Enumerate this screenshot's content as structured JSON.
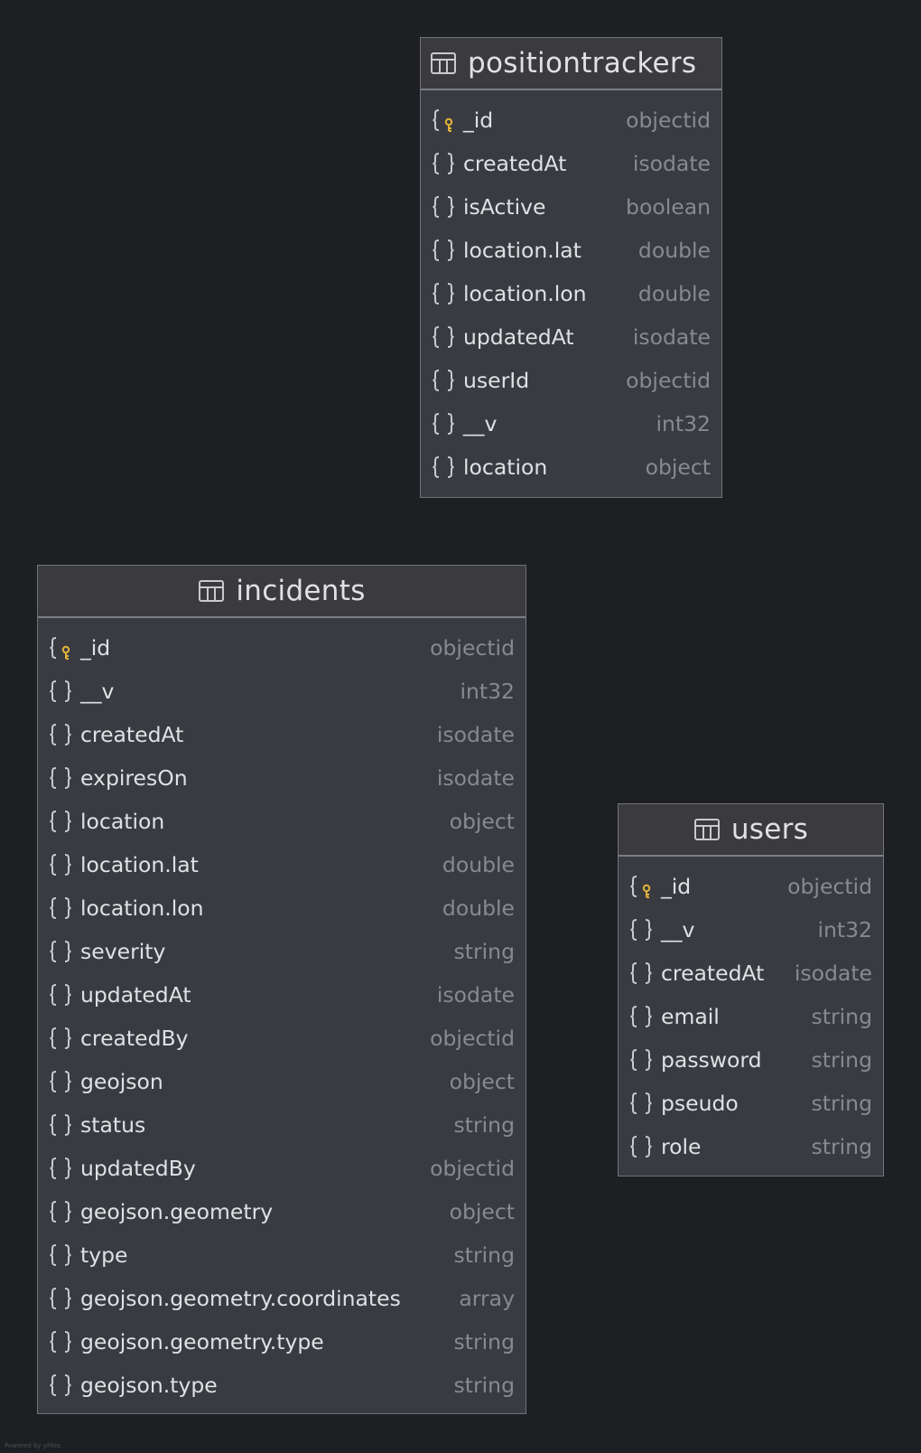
{
  "tables": [
    {
      "name": "positiontrackers",
      "fields": [
        {
          "name": "_id",
          "type": "objectid",
          "key": true
        },
        {
          "name": "createdAt",
          "type": "isodate",
          "key": false
        },
        {
          "name": "isActive",
          "type": "boolean",
          "key": false
        },
        {
          "name": "location.lat",
          "type": "double",
          "key": false
        },
        {
          "name": "location.lon",
          "type": "double",
          "key": false
        },
        {
          "name": "updatedAt",
          "type": "isodate",
          "key": false
        },
        {
          "name": "userId",
          "type": "objectid",
          "key": false
        },
        {
          "name": "__v",
          "type": "int32",
          "key": false
        },
        {
          "name": "location",
          "type": "object",
          "key": false
        }
      ]
    },
    {
      "name": "incidents",
      "fields": [
        {
          "name": "_id",
          "type": "objectid",
          "key": true
        },
        {
          "name": "__v",
          "type": "int32",
          "key": false
        },
        {
          "name": "createdAt",
          "type": "isodate",
          "key": false
        },
        {
          "name": "expiresOn",
          "type": "isodate",
          "key": false
        },
        {
          "name": "location",
          "type": "object",
          "key": false
        },
        {
          "name": "location.lat",
          "type": "double",
          "key": false
        },
        {
          "name": "location.lon",
          "type": "double",
          "key": false
        },
        {
          "name": "severity",
          "type": "string",
          "key": false
        },
        {
          "name": "updatedAt",
          "type": "isodate",
          "key": false
        },
        {
          "name": "createdBy",
          "type": "objectid",
          "key": false
        },
        {
          "name": "geojson",
          "type": "object",
          "key": false
        },
        {
          "name": "status",
          "type": "string",
          "key": false
        },
        {
          "name": "updatedBy",
          "type": "objectid",
          "key": false
        },
        {
          "name": "geojson.geometry",
          "type": "object",
          "key": false
        },
        {
          "name": "type",
          "type": "string",
          "key": false
        },
        {
          "name": "geojson.geometry.coordinates",
          "type": "array",
          "key": false
        },
        {
          "name": "geojson.geometry.type",
          "type": "string",
          "key": false
        },
        {
          "name": "geojson.type",
          "type": "string",
          "key": false
        }
      ]
    },
    {
      "name": "users",
      "fields": [
        {
          "name": "_id",
          "type": "objectid",
          "key": true
        },
        {
          "name": "__v",
          "type": "int32",
          "key": false
        },
        {
          "name": "createdAt",
          "type": "isodate",
          "key": false
        },
        {
          "name": "email",
          "type": "string",
          "key": false
        },
        {
          "name": "password",
          "type": "string",
          "key": false
        },
        {
          "name": "pseudo",
          "type": "string",
          "key": false
        },
        {
          "name": "role",
          "type": "string",
          "key": false
        }
      ]
    }
  ],
  "footer": {
    "powered_by": "Powered by yFiles"
  },
  "colors": {
    "background": "#1e1f22",
    "node": "#393b40",
    "text": "#dfe1e5",
    "type_text": "#868a91",
    "key": "#e0b43a"
  }
}
